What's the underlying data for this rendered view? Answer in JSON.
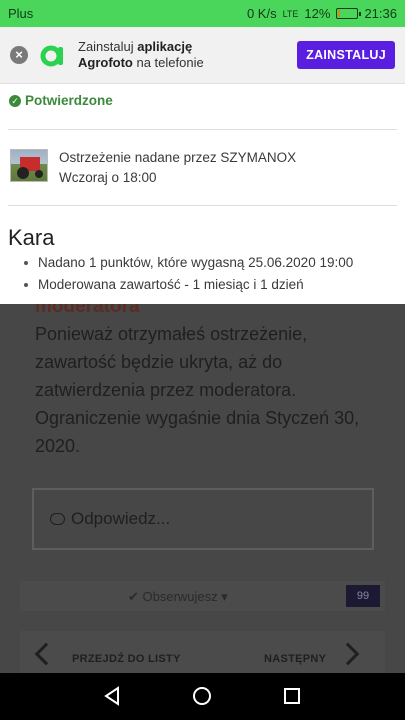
{
  "status_bar": {
    "carrier": "Plus",
    "speed": "0 K/s",
    "network": "LTE",
    "battery": "12%",
    "battery_level": 0.12,
    "time": "21:36"
  },
  "banner": {
    "text_prefix": "Zainstaluj ",
    "text_bold1": "aplikację",
    "text_bold2": "Agrofoto",
    "text_suffix": " na telefonie",
    "install_label": "ZAINSTALUJ",
    "accent_color": "#5a1ee0"
  },
  "card": {
    "status": "Potwierdzone",
    "warning_title": "Ostrzeżenie nadane przez SZYMANOX",
    "warning_time": "Wczoraj o 18:00",
    "penalty_heading": "Kara",
    "penalties": [
      "Nadano 1 punktów, które wygasną 25.06.2020 19:00",
      "Moderowana zawartość - 1 miesiąc i 1 dzień"
    ]
  },
  "background": {
    "moderator_heading": "moderatora",
    "message": "Ponieważ otrzymałeś ostrzeżenie, zawartość będzie ukryta, aż do zatwierdzenia przez moderatora. Ograniczenie wygaśnie dnia Styczeń 30, 2020.",
    "reply_placeholder": "Odpowiedz...",
    "watch_label": "Obserwujesz",
    "watch_count": "99",
    "prev_label": "PRZEJDŹ DO LISTY",
    "next_label": "NASTĘPNY"
  },
  "icons": {
    "close": "close-icon",
    "logo": "agrofoto-logo-icon",
    "check": "check-circle-icon",
    "bubble": "speech-bubble-icon",
    "back": "back-triangle-icon",
    "home": "home-circle-icon",
    "recents": "recents-square-icon"
  }
}
